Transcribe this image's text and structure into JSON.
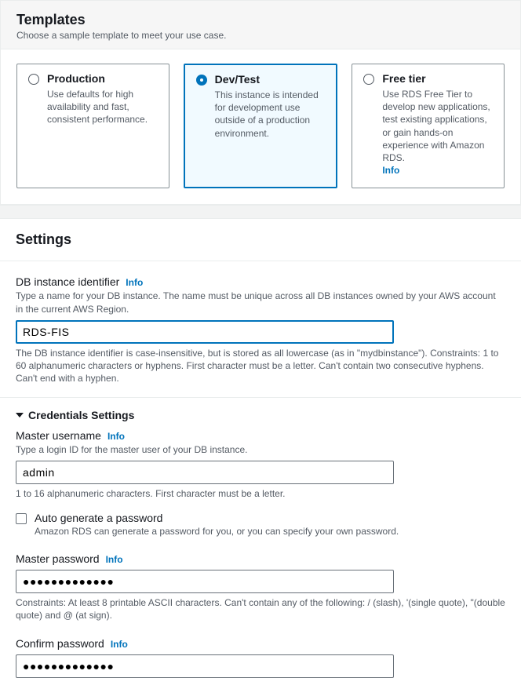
{
  "templates": {
    "title": "Templates",
    "subtitle": "Choose a sample template to meet your use case.",
    "options": [
      {
        "title": "Production",
        "desc": "Use defaults for high availability and fast, consistent performance."
      },
      {
        "title": "Dev/Test",
        "desc": "This instance is intended for development use outside of a production environment."
      },
      {
        "title": "Free tier",
        "desc": "Use RDS Free Tier to develop new applications, test existing applications, or gain hands-on experience with Amazon RDS.",
        "info": "Info"
      }
    ]
  },
  "settings": {
    "title": "Settings",
    "dbid": {
      "label": "DB instance identifier",
      "info": "Info",
      "helper": "Type a name for your DB instance. The name must be unique across all DB instances owned by your AWS account in the current AWS Region.",
      "value": "RDS-FIS",
      "constraint": "The DB instance identifier is case-insensitive, but is stored as all lowercase (as in \"mydbinstance\"). Constraints: 1 to 60 alphanumeric characters or hyphens. First character must be a letter. Can't contain two consecutive hyphens. Can't end with a hyphen."
    },
    "credentials": {
      "subheading": "Credentials Settings",
      "username": {
        "label": "Master username",
        "info": "Info",
        "helper": "Type a login ID for the master user of your DB instance.",
        "value": "admin",
        "constraint": "1 to 16 alphanumeric characters. First character must be a letter."
      },
      "autogen": {
        "label": "Auto generate a password",
        "desc": "Amazon RDS can generate a password for you, or you can specify your own password."
      },
      "password": {
        "label": "Master password",
        "info": "Info",
        "value": "●●●●●●●●●●●●●",
        "constraint": "Constraints: At least 8 printable ASCII characters. Can't contain any of the following: / (slash), '(single quote), \"(double quote) and @ (at sign)."
      },
      "confirm": {
        "label": "Confirm password",
        "info": "Info",
        "value": "●●●●●●●●●●●●●"
      }
    }
  }
}
